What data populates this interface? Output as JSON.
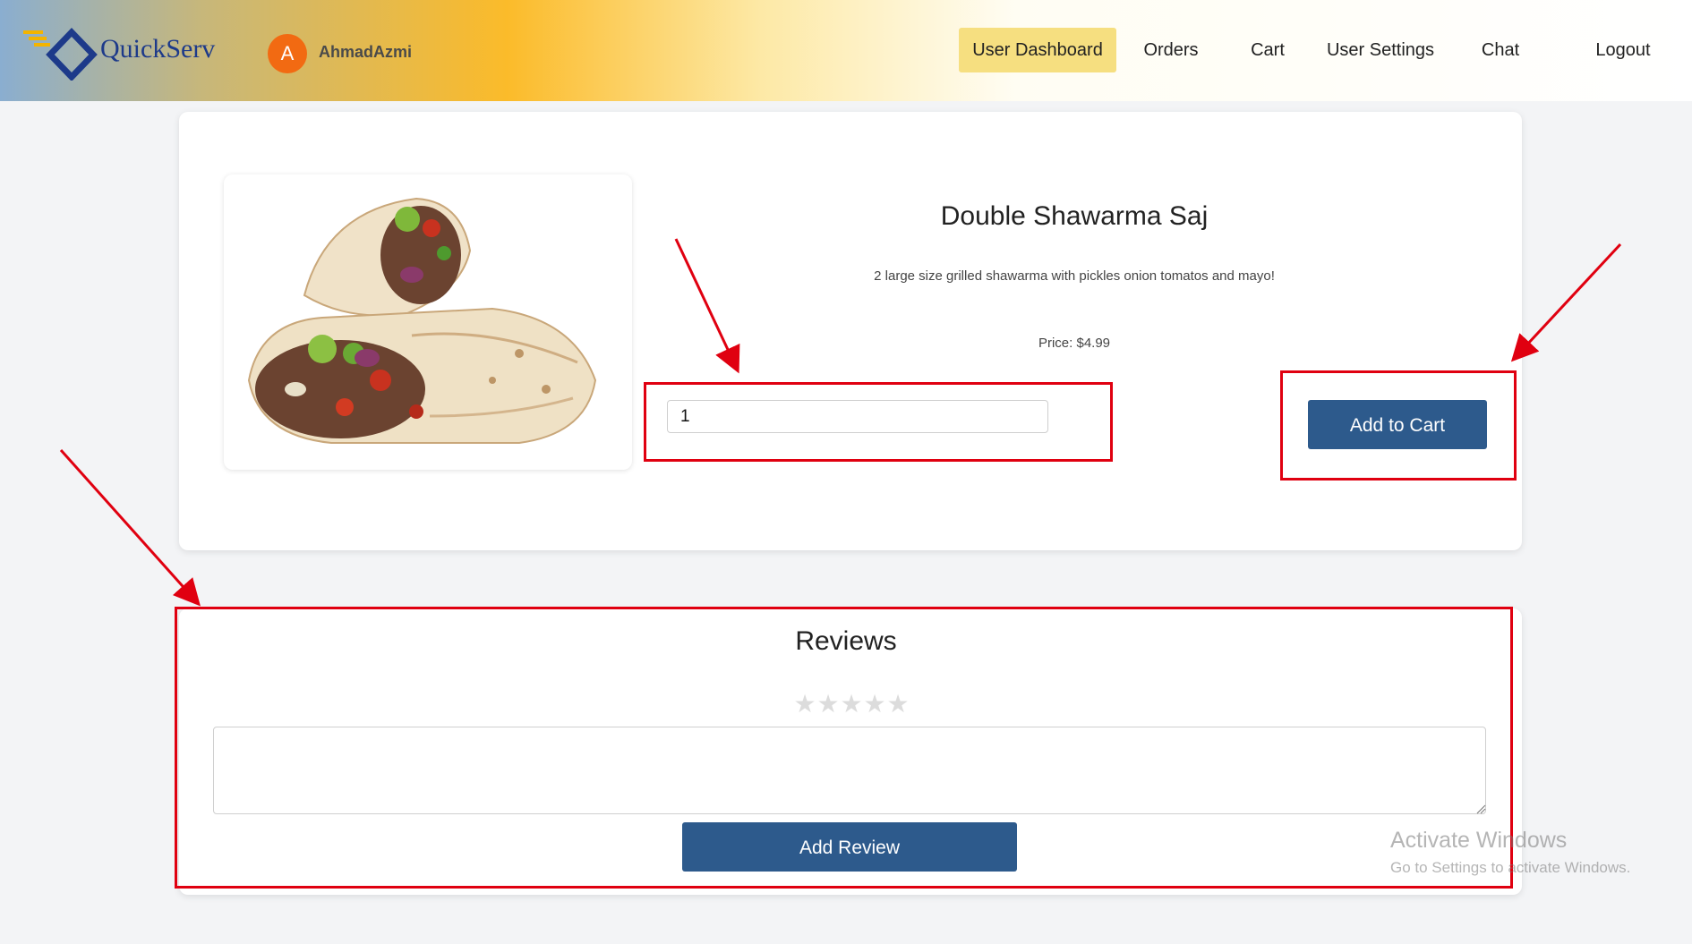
{
  "brand": {
    "name": "QuickServ"
  },
  "user": {
    "initial": "A",
    "name": "AhmadAzmi"
  },
  "nav": {
    "items": [
      {
        "label": "User Dashboard",
        "active": true
      },
      {
        "label": "Orders",
        "active": false
      },
      {
        "label": "Cart",
        "active": false
      },
      {
        "label": "User Settings",
        "active": false
      },
      {
        "label": "Chat",
        "active": false
      },
      {
        "label": "Logout",
        "active": false
      }
    ]
  },
  "product": {
    "title": "Double Shawarma Saj",
    "description": "2 large size grilled shawarma with pickles onion tomatos and mayo!",
    "price_label": "Price:",
    "price": "$4.99",
    "quantity": "1",
    "add_to_cart_label": "Add to Cart",
    "image_icon": "shawarma-image"
  },
  "reviews": {
    "heading": "Reviews",
    "rating": 0,
    "max_rating": 5,
    "star_glyph": "★",
    "text_value": "",
    "add_review_label": "Add Review"
  },
  "watermark": {
    "title": "Activate Windows",
    "subtitle": "Go to Settings to activate Windows."
  },
  "colors": {
    "primary_button": "#2d5a8c",
    "active_nav": "#f6df80",
    "annotation_red": "#e00010",
    "avatar": "#f26a12"
  }
}
